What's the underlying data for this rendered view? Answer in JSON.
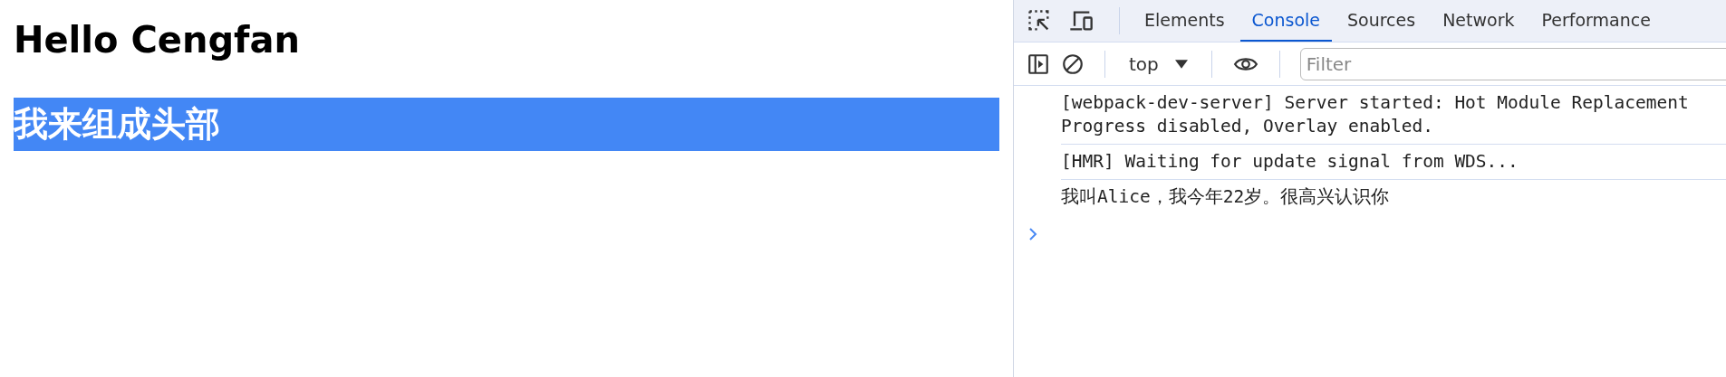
{
  "page": {
    "heading": "Hello Cengfan",
    "header_bar": "我来组成头部"
  },
  "devtools": {
    "tabs": [
      {
        "label": "Elements",
        "selected": false
      },
      {
        "label": "Console",
        "selected": true
      },
      {
        "label": "Sources",
        "selected": false
      },
      {
        "label": "Network",
        "selected": false
      },
      {
        "label": "Performance",
        "selected": false
      }
    ],
    "context": "top",
    "filter": {
      "placeholder": "Filter"
    },
    "messages": [
      {
        "lines": [
          "[webpack-dev-server] Server started: Hot Module Replacement",
          "Progress disabled, Overlay enabled."
        ]
      },
      {
        "lines": [
          "[HMR] Waiting for update signal from WDS..."
        ]
      },
      {
        "lines": [
          "我叫Alice，我今年22岁。很高兴认识你"
        ]
      }
    ]
  }
}
